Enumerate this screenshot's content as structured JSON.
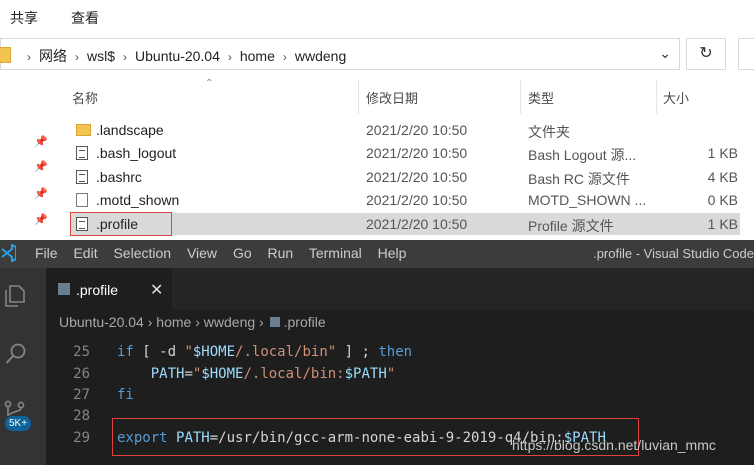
{
  "ribbon": {
    "share": "共享",
    "view": "查看"
  },
  "address": {
    "segments": [
      "网络",
      "wsl$",
      "Ubuntu-20.04",
      "home",
      "wwdeng"
    ]
  },
  "columns": {
    "name": "名称",
    "date": "修改日期",
    "type": "类型",
    "size": "大小"
  },
  "files": [
    {
      "name": ".landscape",
      "date": "2021/2/20 10:50",
      "type": "文件夹",
      "size": "",
      "icon": "folder-icon"
    },
    {
      "name": ".bash_logout",
      "date": "2021/2/20 10:50",
      "type": "Bash Logout 源...",
      "size": "1 KB",
      "icon": "file-icon"
    },
    {
      "name": ".bashrc",
      "date": "2021/2/20 10:50",
      "type": "Bash RC 源文件",
      "size": "4 KB",
      "icon": "file-icon"
    },
    {
      "name": ".motd_shown",
      "date": "2021/2/20 10:50",
      "type": "MOTD_SHOWN ...",
      "size": "0 KB",
      "icon": "file-icon"
    },
    {
      "name": ".profile",
      "date": "2021/2/20 10:50",
      "type": "Profile 源文件",
      "size": "1 KB",
      "icon": "file-icon",
      "selected": true
    }
  ],
  "vscode": {
    "menu": [
      "File",
      "Edit",
      "Selection",
      "View",
      "Go",
      "Run",
      "Terminal",
      "Help"
    ],
    "window_title": ".profile - Visual Studio Code",
    "tab": {
      "label": ".profile",
      "close": "✕"
    },
    "breadcrumb": [
      "Ubuntu-20.04",
      "home",
      "wwdeng",
      ".profile"
    ],
    "badge": "5K+",
    "lines": [
      {
        "n": "25",
        "text": "if [ -d \"$HOME/.local/bin\" ] ; then"
      },
      {
        "n": "26",
        "text": "    PATH=\"$HOME/.local/bin:$PATH\""
      },
      {
        "n": "27",
        "text": "fi"
      },
      {
        "n": "28",
        "text": ""
      },
      {
        "n": "29",
        "text": "export PATH=/usr/bin/gcc-arm-none-eabi-9-2019-q4/bin:$PATH"
      }
    ]
  },
  "watermark": "https://blog.csdn.net/luvian_mmc",
  "colors": {
    "selection": "#d9d9d9",
    "highlight_box": "#e04040",
    "editor_bg": "#1e1e1e",
    "menubar_bg": "#3c3c3c"
  }
}
